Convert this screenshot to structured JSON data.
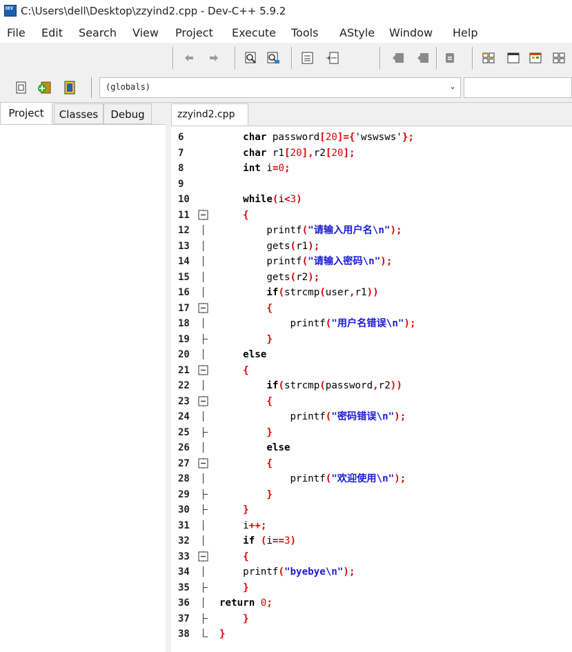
{
  "window": {
    "title": "C:\\Users\\dell\\Desktop\\zzyind2.cpp - Dev-C++ 5.9.2",
    "app_icon_text": "DEV"
  },
  "menu": [
    "File",
    "Edit",
    "Search",
    "View",
    "Project",
    "Execute",
    "Tools",
    "AStyle",
    "Window",
    "Help"
  ],
  "toolbar2": {
    "scope_selector": "(globals)"
  },
  "left_tabs": [
    "Project",
    "Classes",
    "Debug"
  ],
  "editor": {
    "file_tab": "zzyind2.cpp"
  },
  "code_lines": [
    {
      "n": "6",
      "text": "    char password[20]={'wswsws'};"
    },
    {
      "n": "7",
      "text": "    char r1[20],r2[20];"
    },
    {
      "n": "8",
      "text": "    int i=0;"
    },
    {
      "n": "9",
      "text": ""
    },
    {
      "n": "10",
      "text": "    while(i<3)"
    },
    {
      "n": "11",
      "text": "    {"
    },
    {
      "n": "12",
      "text": "        printf(\"请输入用户名\\n\");"
    },
    {
      "n": "13",
      "text": "        gets(r1);"
    },
    {
      "n": "14",
      "text": "        printf(\"请输入密码\\n\");"
    },
    {
      "n": "15",
      "text": "        gets(r2);"
    },
    {
      "n": "16",
      "text": "        if(strcmp(user,r1))"
    },
    {
      "n": "17",
      "text": "        {"
    },
    {
      "n": "18",
      "text": "            printf(\"用户名错误\\n\");"
    },
    {
      "n": "19",
      "text": "        }"
    },
    {
      "n": "20",
      "text": "    else"
    },
    {
      "n": "21",
      "text": "    {"
    },
    {
      "n": "22",
      "text": "        if(strcmp(password,r2))"
    },
    {
      "n": "23",
      "text": "        {"
    },
    {
      "n": "24",
      "text": "            printf(\"密码错误\\n\");"
    },
    {
      "n": "25",
      "text": "        }"
    },
    {
      "n": "26",
      "text": "        else"
    },
    {
      "n": "27",
      "text": "        {"
    },
    {
      "n": "28",
      "text": "            printf(\"欢迎使用\\n\");"
    },
    {
      "n": "29",
      "text": "        }"
    },
    {
      "n": "30",
      "text": "    }"
    },
    {
      "n": "31",
      "text": "    i++;"
    },
    {
      "n": "32",
      "text": "    if (i==3)"
    },
    {
      "n": "33",
      "text": "    {"
    },
    {
      "n": "34",
      "text": "    printf(\"byebye\\n\");"
    },
    {
      "n": "35",
      "text": "    }"
    },
    {
      "n": "36",
      "text": "return 0;"
    },
    {
      "n": "37",
      "text": "    }"
    },
    {
      "n": "38",
      "text": "}"
    }
  ],
  "fold_markers": {
    "11": "minus",
    "17": "minus",
    "21": "minus",
    "23": "minus",
    "27": "minus",
    "33": "minus",
    "19": "end",
    "25": "end",
    "29": "end",
    "30": "end",
    "35": "end",
    "37": "end",
    "38": "last"
  },
  "colors": {
    "keyword": "#000000",
    "number": "#e00000",
    "string": "#1a1ad8",
    "gutter_text": "#222222"
  },
  "toolbar_icons": [
    "undo-icon",
    "redo-icon",
    "find-icon",
    "replace-icon",
    "list-icon",
    "insert-icon",
    "bookmark-prev-icon",
    "bookmark-next-icon",
    "bookmark-icon",
    "tile-icon",
    "window-icon",
    "compile-icon",
    "grid-icon",
    "project-new-icon",
    "add-to-project-icon",
    "remove-from-project-icon"
  ]
}
